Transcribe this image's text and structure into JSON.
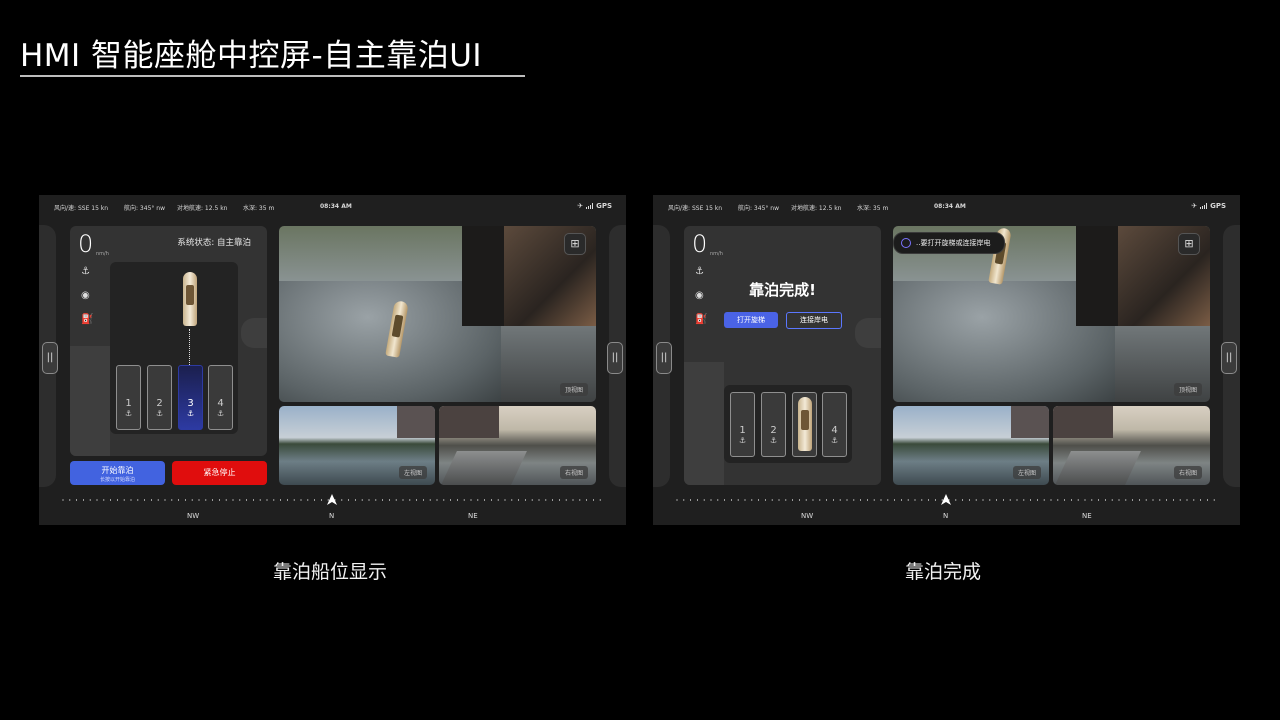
{
  "page_title": "HMI 智能座舱中控屏-自主靠泊UI",
  "status_bar": {
    "wind": "风向/速: SSE 15 kn",
    "heading": "航向: 345° nw",
    "sog": "对地航速: 12.5 kn",
    "depth": "水深: 35 m",
    "time": "08:34 AM",
    "gps": "GPS"
  },
  "left_screen": {
    "speed": "0",
    "speed_unit": "nm/h",
    "system_status": "系统状态: 自主靠泊",
    "slots": [
      "1",
      "2",
      "3",
      "4"
    ],
    "active_slot": "3",
    "start_button": "开始靠泊",
    "start_hint": "长按以开始靠泊",
    "stop_button": "紧急停止",
    "camera_labels": {
      "top": "顶视图",
      "left": "左视图",
      "right": "右视图"
    },
    "compass": [
      "NW",
      "N",
      "NE"
    ],
    "caption": "靠泊船位显示"
  },
  "right_screen": {
    "speed": "0",
    "speed_unit": "nm/h",
    "docking_complete": "靠泊完成!",
    "open_ladder_button": "打开旋梯",
    "shore_power_button": "连接岸电",
    "toast": "..要打开旋梯或连接岸电",
    "slots": [
      "1",
      "2",
      "3",
      "4"
    ],
    "occupied_slot": "3",
    "camera_labels": {
      "top": "顶视图",
      "left": "左视图",
      "right": "右视图"
    },
    "compass": [
      "NW",
      "N",
      "NE"
    ],
    "caption": "靠泊完成"
  },
  "colors": {
    "primary": "#4263e0",
    "danger": "#e00d0d",
    "panel": "#333333",
    "screen": "#1f1f1f"
  },
  "icons": [
    "anchor-icon",
    "camera-icon",
    "fuel-icon",
    "satellite-icon",
    "signal-icon",
    "camera-switch-icon",
    "compass-pointer-icon",
    "pause-handle-icon"
  ]
}
